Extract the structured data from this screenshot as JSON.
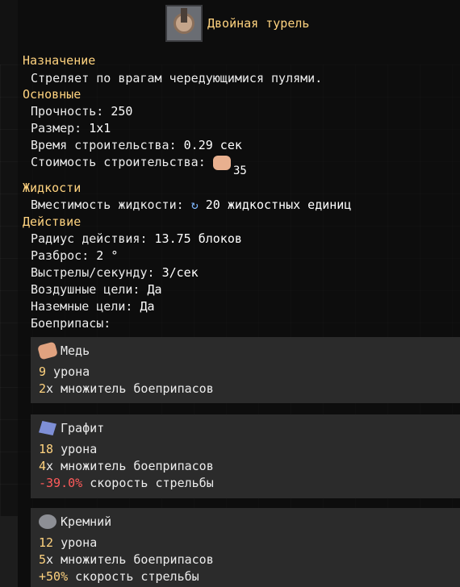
{
  "title": "Двойная турель",
  "sections": {
    "purpose": "Назначение",
    "general": "Основные",
    "liquids": "Жидкости",
    "action": "Действие"
  },
  "description": "Стреляет по врагам чередующимися пулями.",
  "stats": {
    "durability_label": "Прочность:",
    "durability_value": "250",
    "size_label": "Размер:",
    "size_value": "1x1",
    "build_time_label": "Время строительства:",
    "build_time_value": "0.29 сек",
    "build_cost_label": "Стоимость строительства:",
    "build_cost_count": "35",
    "liquid_capacity_label": "Вместимость жидкости:",
    "liquid_capacity_value": "20 жидкостных единиц",
    "range_label": "Радиус действия:",
    "range_value": "13.75 блоков",
    "inaccuracy_label": "Разброс:",
    "inaccuracy_value": "2 °",
    "shots_label": "Выстрелы/секунду:",
    "shots_value": "3/сек",
    "air_label": "Воздушные цели:",
    "air_value": "Да",
    "ground_label": "Наземные цели:",
    "ground_value": "Да",
    "ammo_label": "Боеприпасы:"
  },
  "ammo": [
    {
      "name": "Медь",
      "icon": "copper-icon",
      "damage_num": "9",
      "damage_text": " урона",
      "mult_num": "2",
      "mult_text": "x множитель боеприпасов"
    },
    {
      "name": "Графит",
      "icon": "graphite-icon",
      "damage_num": "18",
      "damage_text": " урона",
      "mult_num": "4",
      "mult_text": "x множитель боеприпасов",
      "rate_num": "-39.0%",
      "rate_text": " скорость стрельбы"
    },
    {
      "name": "Кремний",
      "icon": "silicon-icon",
      "damage_num": "12",
      "damage_text": " урона",
      "mult_num": "5",
      "mult_text": "x множитель боеприпасов",
      "rate_num": "+50%",
      "rate_text": " скорость стрельбы"
    }
  ],
  "colors": {
    "accent": "#ffd37f",
    "negative": "#ff5b5b",
    "card": "#2b2b2b"
  }
}
